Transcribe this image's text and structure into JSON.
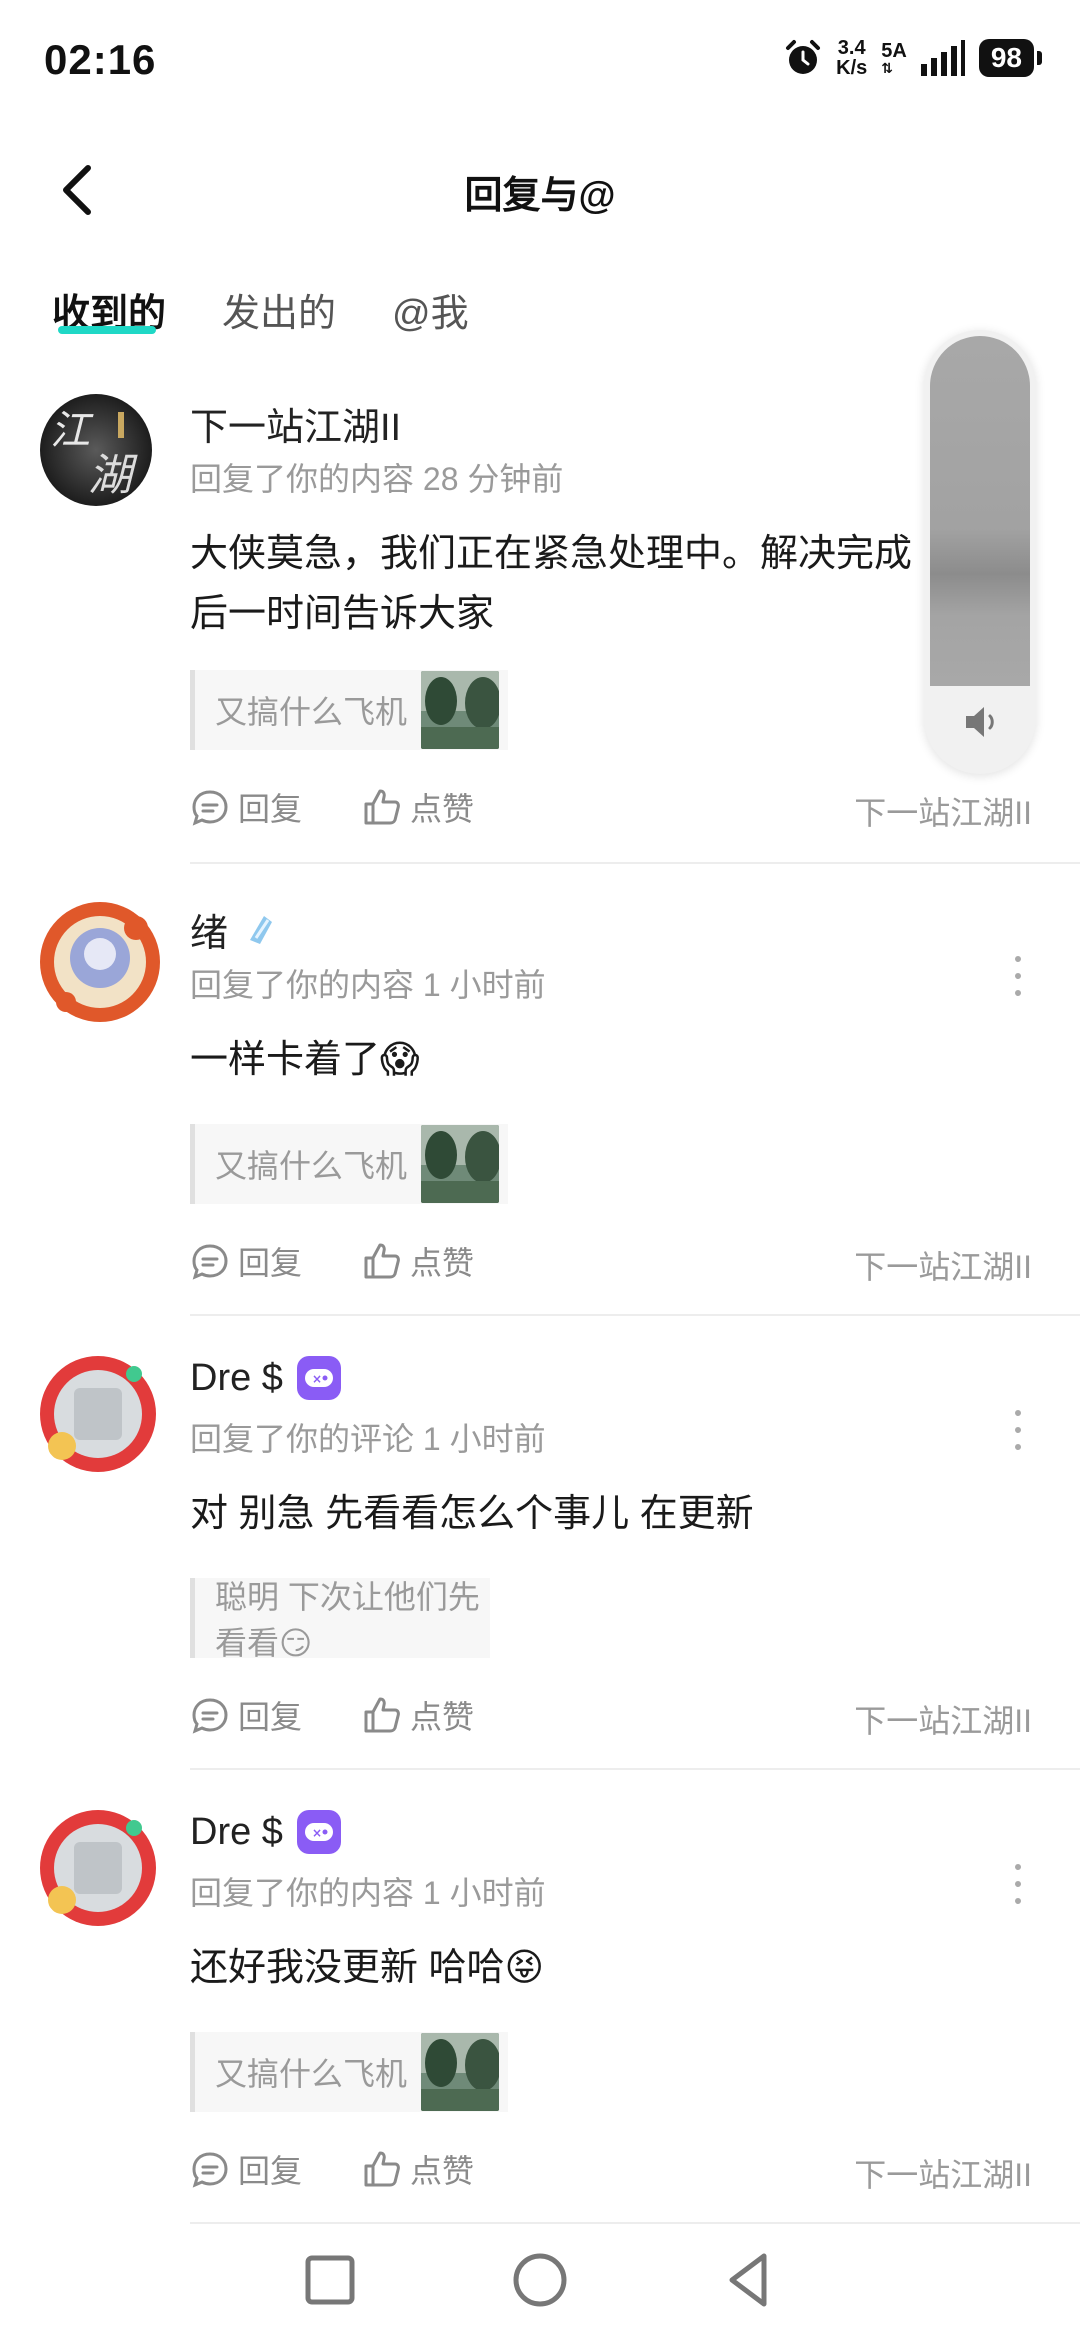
{
  "status_bar": {
    "time": "02:16",
    "net_speed_value": "3.4",
    "net_speed_unit": "K/s",
    "signal_label": "5A",
    "battery": "98"
  },
  "header": {
    "title": "回复与@"
  },
  "tabs": [
    {
      "label": "收到的",
      "active": true
    },
    {
      "label": "发出的",
      "active": false
    },
    {
      "label": "@我",
      "active": false
    }
  ],
  "items": [
    {
      "username": "下一站江湖II",
      "meta": "回复了你的内容 28 分钟前",
      "content": "大侠莫急，我们正在紧急处理中。解决完成后一时间告诉大家",
      "quote": "又搞什么飞机",
      "reply_label": "回复",
      "like_label": "点赞",
      "source": "下一站江湖II"
    },
    {
      "username": "绪",
      "meta": "回复了你的内容 1 小时前",
      "content": "一样卡着了😱",
      "quote": "又搞什么飞机",
      "reply_label": "回复",
      "like_label": "点赞",
      "source": "下一站江湖II"
    },
    {
      "username": "Dre $",
      "meta": "回复了你的评论 1 小时前",
      "content": "对  别急  先看看怎么个事儿 在更新",
      "quote": "聪明 下次让他们先看看😏",
      "reply_label": "回复",
      "like_label": "点赞",
      "source": "下一站江湖II"
    },
    {
      "username": "Dre $",
      "meta": "回复了你的内容 1 小时前",
      "content": "还好我没更新  哈哈😝",
      "quote": "又搞什么飞机",
      "reply_label": "回复",
      "like_label": "点赞",
      "source": "下一站江湖II"
    }
  ],
  "colors": {
    "tab_underline": "#1fd8c6",
    "badge_purple": "#8a5cf5",
    "meta_gray": "#9a9a9a"
  }
}
